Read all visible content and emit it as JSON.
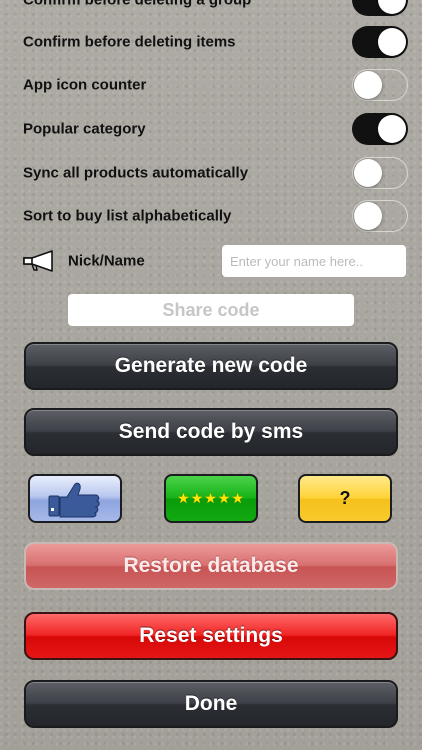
{
  "settings": [
    {
      "label": "Confirm before deleting a group",
      "state": "on"
    },
    {
      "label": "Confirm before deleting items",
      "state": "on"
    },
    {
      "label": "App icon counter",
      "state": "off"
    },
    {
      "label": "Popular category",
      "state": "on"
    },
    {
      "label": "Sync all products automatically",
      "state": "off"
    },
    {
      "label": "Sort to buy list alphabetically",
      "state": "off"
    }
  ],
  "nick": {
    "label": "Nick/Name",
    "value": "",
    "placeholder": "Enter your name here..",
    "icon": "megaphone-icon"
  },
  "share": {
    "placeholder": "Share code"
  },
  "buttons": {
    "generate": "Generate new code",
    "send_sms": "Send code by sms",
    "like_icon": "thumbs-up-icon",
    "rate_stars": "★★★★★",
    "help": "?",
    "restore": "Restore database",
    "reset": "Reset settings",
    "done": "Done"
  }
}
